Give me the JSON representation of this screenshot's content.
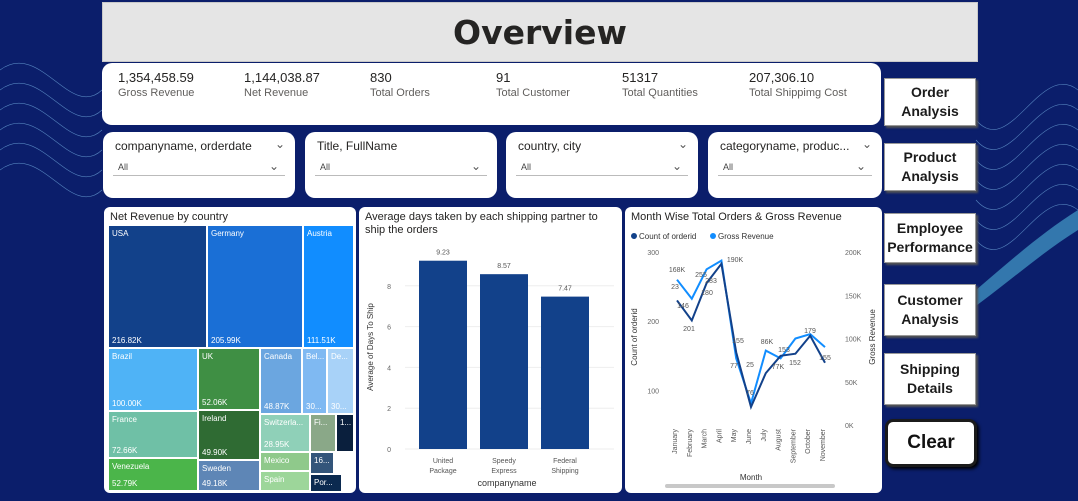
{
  "title": "Overview",
  "kpis": [
    {
      "value": "1,354,458.59",
      "label": "Gross Revenue"
    },
    {
      "value": "1,144,038.87",
      "label": "Net Revenue"
    },
    {
      "value": "830",
      "label": "Total Orders"
    },
    {
      "value": "91",
      "label": "Total Customer"
    },
    {
      "value": "51317",
      "label": "Total Quantities"
    },
    {
      "value": "207,306.10",
      "label": "Total Shippimg Cost"
    }
  ],
  "nav": {
    "order_analysis": "Order Analysis",
    "product_analysis": "Product Analysis",
    "employee_performance": "Employee Performance",
    "customer_analysis": "Customer Analysis",
    "shipping_details": "Shipping Details",
    "clear": "Clear"
  },
  "slicers": [
    {
      "header": "companyname, orderdate",
      "value": "All"
    },
    {
      "header": "Title, FullName",
      "value": "All"
    },
    {
      "header": "country, city",
      "value": "All"
    },
    {
      "header": "categoryname, produc...",
      "value": "All"
    }
  ],
  "treemap": {
    "title": "Net Revenue by country",
    "tiles": [
      {
        "name": "USA",
        "value": "216.82K",
        "color": "#12418a"
      },
      {
        "name": "Germany",
        "value": "205.99K",
        "color": "#1a6fd6"
      },
      {
        "name": "Austria",
        "value": "111.51K",
        "color": "#118dff"
      },
      {
        "name": "Brazil",
        "value": "100.00K",
        "color": "#4fb3f6"
      },
      {
        "name": "UK",
        "value": "52.06K",
        "color": "#3f8f44"
      },
      {
        "name": "Canada",
        "value": "48.87K",
        "color": "#6ba6e0"
      },
      {
        "name": "Bel...",
        "value": "30...",
        "color": "#7fb9f2"
      },
      {
        "name": "De...",
        "value": "30...",
        "color": "#a8d2f8"
      },
      {
        "name": "France",
        "value": "72.66K",
        "color": "#6fc0a6"
      },
      {
        "name": "Ireland",
        "value": "49.90K",
        "color": "#2f6b33"
      },
      {
        "name": "Switzerla...",
        "value": "28.95K",
        "color": "#8fd0b8"
      },
      {
        "name": "Fi...",
        "value": "",
        "color": "#8aa888"
      },
      {
        "name": "Mexico",
        "value": "",
        "color": "#8fc98b"
      },
      {
        "name": "Venezuela",
        "value": "52.79K",
        "color": "#4bb54a"
      },
      {
        "name": "Sweden",
        "value": "49.18K",
        "color": "#5e86b6"
      },
      {
        "name": "Spain",
        "value": "",
        "color": "#9dd69a"
      },
      {
        "name": "16...",
        "value": "",
        "color": "#33557a"
      },
      {
        "name": "Por...",
        "value": "",
        "color": "#0b2a50"
      },
      {
        "name": "1...",
        "value": "",
        "color": "#0a1f3d"
      }
    ]
  },
  "bar_chart": {
    "title": "Average days taken by each shipping partner to ship the orders",
    "xlabel": "companyname",
    "ylabel": "Average of Days To Ship",
    "yticks": [
      "0",
      "2",
      "4",
      "6",
      "8"
    ],
    "categories": [
      "United Package",
      "Speedy Express",
      "Federal Shipping"
    ],
    "values": [
      9.23,
      8.57,
      7.47
    ],
    "value_labels": [
      "9.23",
      "8.57",
      "7.47"
    ],
    "color": "#12418a"
  },
  "line_chart": {
    "title": "Month Wise Total Orders & Gross Revenue",
    "legend": [
      "Count of orderid",
      "Gross Revenue"
    ],
    "colors": [
      "#12418a",
      "#118dff"
    ],
    "xlabel": "Month",
    "ylabel_left": "Count of orderid",
    "ylabel_right": "Gross Revenue",
    "left_ticks": [
      "300",
      "200",
      "100"
    ],
    "right_ticks": [
      "200K",
      "150K",
      "100K",
      "50K",
      "0K"
    ],
    "months": [
      "January",
      "February",
      "March",
      "April",
      "May",
      "June",
      "July",
      "August",
      "September",
      "October",
      "November"
    ],
    "labels": [
      "168K",
      "23",
      "146",
      "201",
      "255",
      "180",
      "283",
      "190K",
      "155",
      "77",
      "25",
      "76",
      "86K",
      "153",
      "77K",
      "152",
      "179",
      "155"
    ]
  },
  "chart_data": [
    {
      "type": "bar",
      "title": "Average days taken by each shipping partner to ship the orders",
      "xlabel": "companyname",
      "ylabel": "Average of Days To Ship",
      "categories": [
        "United Package",
        "Speedy Express",
        "Federal Shipping"
      ],
      "values": [
        9.23,
        8.57,
        7.47
      ],
      "ylim": [
        0,
        10
      ]
    },
    {
      "type": "line",
      "title": "Month Wise Total Orders & Gross Revenue",
      "xlabel": "Month",
      "x": [
        "January",
        "February",
        "March",
        "April",
        "May",
        "June",
        "July",
        "August",
        "September",
        "October",
        "November"
      ],
      "series": [
        {
          "name": "Count of orderid",
          "values": [
            230,
            201,
            255,
            283,
            155,
            76,
            125,
            150,
            153,
            179,
            140
          ]
        },
        {
          "name": "Gross Revenue",
          "values": [
            168000,
            146000,
            180000,
            190000,
            77000,
            25000,
            86000,
            77000,
            100000,
            105000,
            90000
          ]
        }
      ],
      "ylim_left": [
        50,
        300
      ],
      "ylim_right": [
        0,
        200000
      ]
    }
  ]
}
